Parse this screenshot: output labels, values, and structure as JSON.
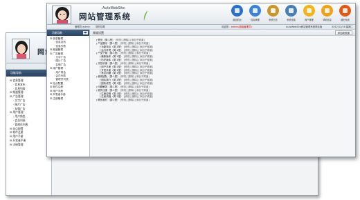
{
  "back_window": {
    "logo": "网站",
    "side_title": "功能导航",
    "strip_left": "管理员:",
    "tree": [
      {
        "label": "信息管理",
        "level": 1
      },
      {
        "label": "信息发布",
        "level": 2
      },
      {
        "label": "信息列表",
        "level": 2
      },
      {
        "label": "频道管理",
        "level": 1
      },
      {
        "label": "广告管理",
        "level": 1
      },
      {
        "label": "文字广告",
        "level": 2
      },
      {
        "label": "图片广告",
        "level": 2
      },
      {
        "label": "友情广告",
        "level": 2
      },
      {
        "label": "用户管理",
        "level": 1
      },
      {
        "label": "用户角色",
        "level": 2
      },
      {
        "label": "会员列表",
        "level": 2
      },
      {
        "label": "管理员列表",
        "level": 2
      },
      {
        "label": "站点配置",
        "level": 1
      },
      {
        "label": "软件注册",
        "level": 1
      },
      {
        "label": "用户手册",
        "level": 1
      },
      {
        "label": "开发者手册",
        "level": 1
      },
      {
        "label": "注册管理",
        "level": 1
      }
    ]
  },
  "header": {
    "logo_en": "AutoWebSite",
    "logo": "网站管理系统",
    "toolbar": [
      {
        "icon": "windows-icon",
        "label": "返回前台",
        "color": "#2a6fc9"
      },
      {
        "icon": "manage-icon",
        "label": "信息管理",
        "color": "#3a83d8"
      },
      {
        "icon": "chart-icon",
        "label": "系统日志",
        "color": "#c9962a"
      },
      {
        "icon": "settings-icon",
        "label": "系统设置",
        "color": "#4a7fb6"
      },
      {
        "icon": "user-icon",
        "label": "用户管理",
        "color": "#f2b419"
      },
      {
        "icon": "help-icon",
        "label": "帮助信息",
        "color": "#f0a31a"
      },
      {
        "icon": "exit-icon",
        "label": "退出系统",
        "color": "#e25a12"
      }
    ]
  },
  "strip": {
    "left": "管理员:admin",
    "location": "您的位置",
    "welcome_prefix": "欢迎您：",
    "welcome_user": "admin",
    "welcome_suffix": "(超级管理员)",
    "system": "AutoWebSite网站管理系统简化版",
    "date": "2012/12/18 星期二"
  },
  "sidebar": {
    "title": "功能导航",
    "tree": [
      {
        "label": "信息管理",
        "level": 1
      },
      {
        "label": "信息发布",
        "level": 2
      },
      {
        "label": "信息列表",
        "level": 2
      },
      {
        "label": "频道管理",
        "level": 1
      },
      {
        "label": "广告管理",
        "level": 1
      },
      {
        "label": "文字广告",
        "level": 2
      },
      {
        "label": "图片广告",
        "level": 2
      },
      {
        "label": "友情广告",
        "level": 2
      },
      {
        "label": "用户管理",
        "level": 1
      },
      {
        "label": "用户角色",
        "level": 2
      },
      {
        "label": "会员列表",
        "level": 2
      },
      {
        "label": "管理员列表",
        "level": 2
      },
      {
        "label": "站点配置",
        "level": 1
      },
      {
        "label": "软件注册",
        "level": 1
      },
      {
        "label": "用户手册",
        "level": 1
      },
      {
        "label": "开发者手册",
        "level": 1
      },
      {
        "label": "注册管理",
        "level": 1
      }
    ]
  },
  "panel": {
    "title": "频道设置",
    "add_button": "添加新频道"
  },
  "menu_rows": [
    {
      "indent": 0,
      "name": "首页",
      "action": "[修改] [删除] [添加子频道]"
    },
    {
      "indent": 0,
      "name": "产品展示",
      "action": "[修改] [删除] [添加子频道]"
    },
    {
      "indent": 1,
      "name": "功能特点",
      "action": "[修改] [删除] [添加子频道]"
    },
    {
      "indent": 1,
      "name": "运行环境",
      "action": "[修改] [删除] [添加子频道]"
    },
    {
      "indent": 0,
      "name": "产品下载",
      "action": "[修改] [删除] [添加子频道]"
    },
    {
      "indent": 1,
      "name": "最新版本",
      "action": "[修改] [删除] [添加子频道]"
    },
    {
      "indent": 1,
      "name": "历史版本",
      "action": "[修改] [删除] [添加子频道]"
    },
    {
      "indent": 0,
      "name": "文档手册",
      "action": "[修改] [删除] [添加子频道]"
    },
    {
      "indent": 1,
      "name": "用户手册",
      "action": "[修改] [删除] [添加子频道]"
    },
    {
      "indent": 1,
      "name": "开发手册",
      "action": "[修改] [删除] [添加子频道]"
    },
    {
      "indent": 1,
      "name": "常见问题",
      "action": "[修改] [删除] [添加子频道]"
    },
    {
      "indent": 0,
      "name": "使用团队",
      "action": "[修改] [删除] [添加子频道]"
    },
    {
      "indent": 1,
      "name": "团队简介",
      "action": "[修改] [删除] [添加子频道]"
    },
    {
      "indent": 1,
      "name": "团队成员",
      "action": "[修改] [删除] [添加子频道]"
    },
    {
      "indent": 0,
      "name": "问题解答",
      "action": "[修改] [删除] [添加子频道]"
    },
    {
      "indent": 0,
      "name": "软件注册",
      "action": "[修改] [删除] [添加子频道]"
    },
    {
      "indent": 1,
      "name": "注册说明",
      "action": "[修改] [删除] [添加子频道]"
    },
    {
      "indent": 1,
      "name": "注册流程",
      "action": "[修改] [删除] [添加子频道]"
    },
    {
      "indent": 0,
      "name": "联系我们",
      "action": "[修改] [删除] [添加子频道]"
    }
  ]
}
